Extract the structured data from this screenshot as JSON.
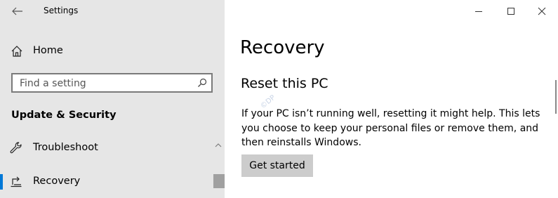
{
  "app": {
    "title": "Settings"
  },
  "sidebar": {
    "home_label": "Home",
    "search_placeholder": "Find a setting",
    "section_title": "Update & Security",
    "items": [
      {
        "label": "Troubleshoot",
        "icon": "wrench-icon"
      },
      {
        "label": "Recovery",
        "icon": "recovery-icon",
        "selected": true
      }
    ]
  },
  "main": {
    "page_title": "Recovery",
    "section_title": "Reset this PC",
    "description": "If your PC isn’t running well, resetting it might help. This lets you choose to keep your personal files or remove them, and then reinstalls Windows.",
    "button_label": "Get started",
    "watermark": "©DP"
  },
  "colors": {
    "sidebar_bg": "#e6e6e6",
    "accent": "#0078d7",
    "button_bg": "#cccccc"
  }
}
